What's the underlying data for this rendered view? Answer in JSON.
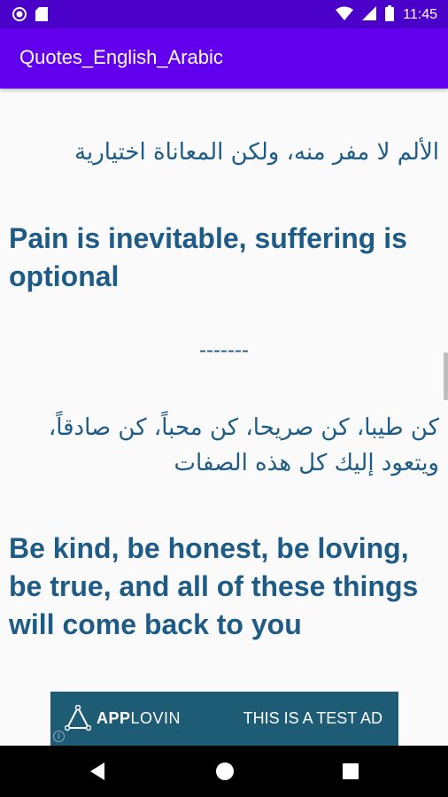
{
  "status_bar": {
    "time": "11:45",
    "left_icons": [
      "circle-notification-icon",
      "sd-card-icon"
    ],
    "right_icons": [
      "wifi-icon",
      "cell-signal-icon",
      "battery-icon"
    ]
  },
  "app_bar": {
    "title": "Quotes_English_Arabic"
  },
  "quotes": [
    {
      "arabic": "الألم لا مفر منه، ولكن المعاناة اختيارية",
      "english": "Pain is inevitable, suffering is optional"
    },
    {
      "arabic": "كن طيبا، كن صريحا، كن محباً، كن صادقاً، ويتعود إليك كل هذه الصفات",
      "english": "Be kind, be honest, be loving, be true, and all of these things will come back to you"
    }
  ],
  "separator": "-------",
  "ad": {
    "brand_prefix": "APP",
    "brand_suffix": "LOVIN",
    "text": "THIS IS A TEST AD",
    "info_glyph": "i"
  },
  "colors": {
    "status_bar": "#4a00c8",
    "app_bar": "#6200ee",
    "quote_text": "#1e5b86",
    "ad_background": "#1e5b75"
  }
}
